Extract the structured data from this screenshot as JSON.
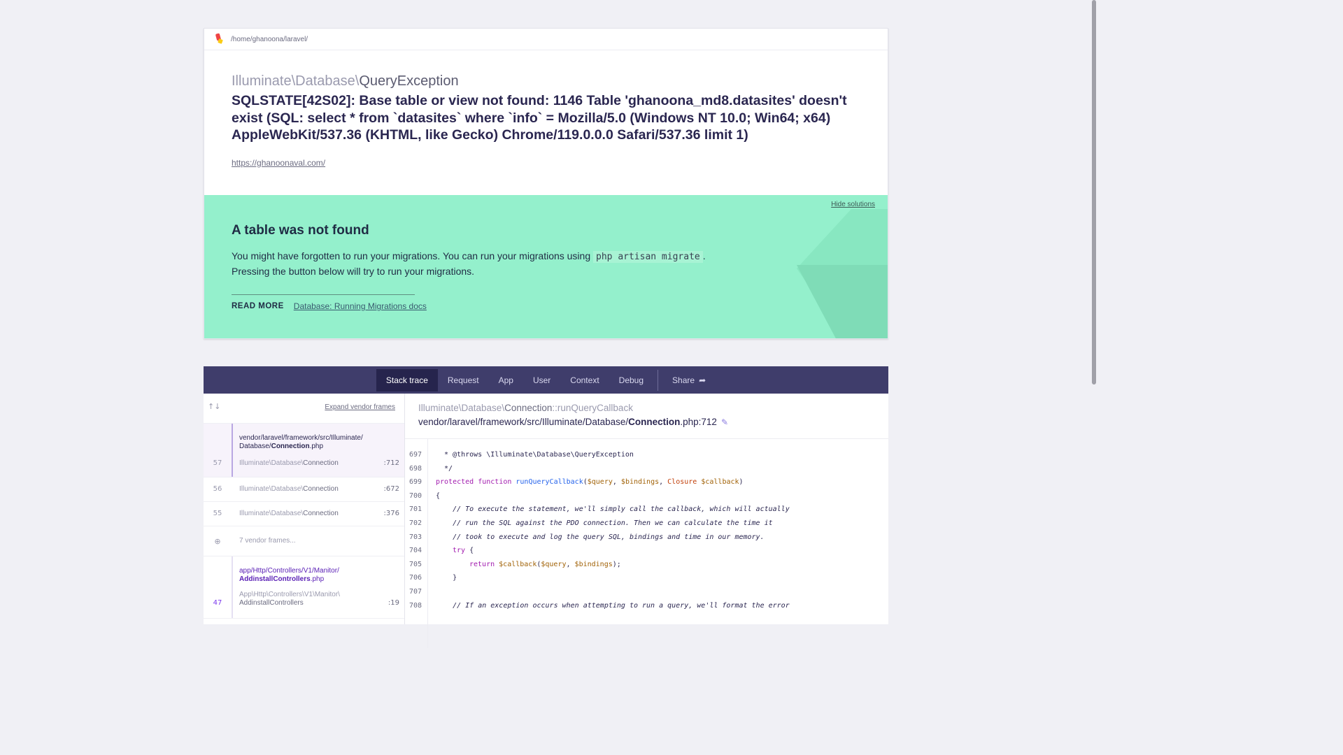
{
  "topbar": {
    "path": "/home/ghanoona/laravel/"
  },
  "exception": {
    "class_prefix": "Illuminate\\Database\\",
    "class_name": "QueryException",
    "message": "SQLSTATE[42S02]: Base table or view not found: 1146 Table 'ghanoona_md8.datasites' doesn't exist (SQL: select * from `datasites` where `info` = Mozilla/5.0 (Windows NT 10.0; Win64; x64) AppleWebKit/537.36 (KHTML, like Gecko) Chrome/119.0.0.0 Safari/537.36 limit 1)",
    "url": "https://ghanoonaval.com/"
  },
  "solution": {
    "hide_label": "Hide solutions",
    "title": "A table was not found",
    "desc_before": "You might have forgotten to run your migrations. You can run your migrations using ",
    "desc_code": "php artisan migrate",
    "desc_after": ".",
    "desc_line2": "Pressing the button below will try to run your migrations.",
    "read_more_label": "READ MORE",
    "read_more_link": "Database: Running Migrations docs"
  },
  "tabs": [
    "Stack trace",
    "Request",
    "App",
    "User",
    "Context",
    "Debug"
  ],
  "share_label": "Share",
  "frames_panel": {
    "expand_label": "Expand vendor frames",
    "arrows": "↑↓"
  },
  "frames": [
    {
      "num": "57",
      "file_line1": "vendor/laravel/framework/src/Illuminate/",
      "file_line2_prefix": "Database/",
      "file_line2_bold": "Connection",
      "file_line2_ext": ".php",
      "cls_prefix": "Illuminate\\Database\\",
      "cls_name": "Connection",
      "line": ":712"
    },
    {
      "num": "56",
      "cls_prefix": "Illuminate\\Database\\",
      "cls_name": "Connection",
      "line": ":672"
    },
    {
      "num": "55",
      "cls_prefix": "Illuminate\\Database\\",
      "cls_name": "Connection",
      "line": ":376"
    },
    {
      "vendor_label": "7 vendor frames..."
    },
    {
      "num": "47",
      "file_line1": "app/Http/Controllers/V1/Manitor/",
      "file_line2_bold": "AddinstallControllers",
      "file_line2_ext": ".php",
      "cls_line1": "App\\Http\\Controllers\\V1\\Manitor\\",
      "cls_line2": "AddinstallControllers",
      "line": ":19"
    }
  ],
  "code": {
    "class_prefix": "Illuminate\\Database\\",
    "class_name": "Connection",
    "method": "::runQueryCallback",
    "file_prefix": "vendor/laravel/framework/src/Illuminate/Database/",
    "file_bold": "Connection",
    "file_suffix": ".php:712",
    "line_numbers": [
      "697",
      "698",
      "699",
      "700",
      "701",
      "702",
      "703",
      "704",
      "705",
      "706",
      "707",
      "708"
    ],
    "l697": " * @throws \\Illuminate\\Database\\QueryException",
    "l698": " */",
    "l699_kw": "protected function ",
    "l699_fn": "runQueryCallback",
    "l699_a": "(",
    "l699_v1": "$query",
    "l699_b": ", ",
    "l699_v2": "$bindings",
    "l699_c": ", ",
    "l699_cl": "Closure",
    "l699_d": " ",
    "l699_v3": "$callback",
    "l699_e": ")",
    "l700": "{",
    "l701": "    // To execute the statement, we'll simply call the callback, which will actually",
    "l702": "    // run the SQL against the PDO connection. Then we can calculate the time it",
    "l703": "    // took to execute and log the query SQL, bindings and time in our memory.",
    "l704_kw": "try",
    "l704_rest": " {",
    "l705_kw": "return ",
    "l705_v1": "$callback",
    "l705_a": "(",
    "l705_v2": "$query",
    "l705_b": ", ",
    "l705_v3": "$bindings",
    "l705_c": ");",
    "l706": "    }",
    "l707": "",
    "l708": "    // If an exception occurs when attempting to run a query, we'll format the error"
  }
}
